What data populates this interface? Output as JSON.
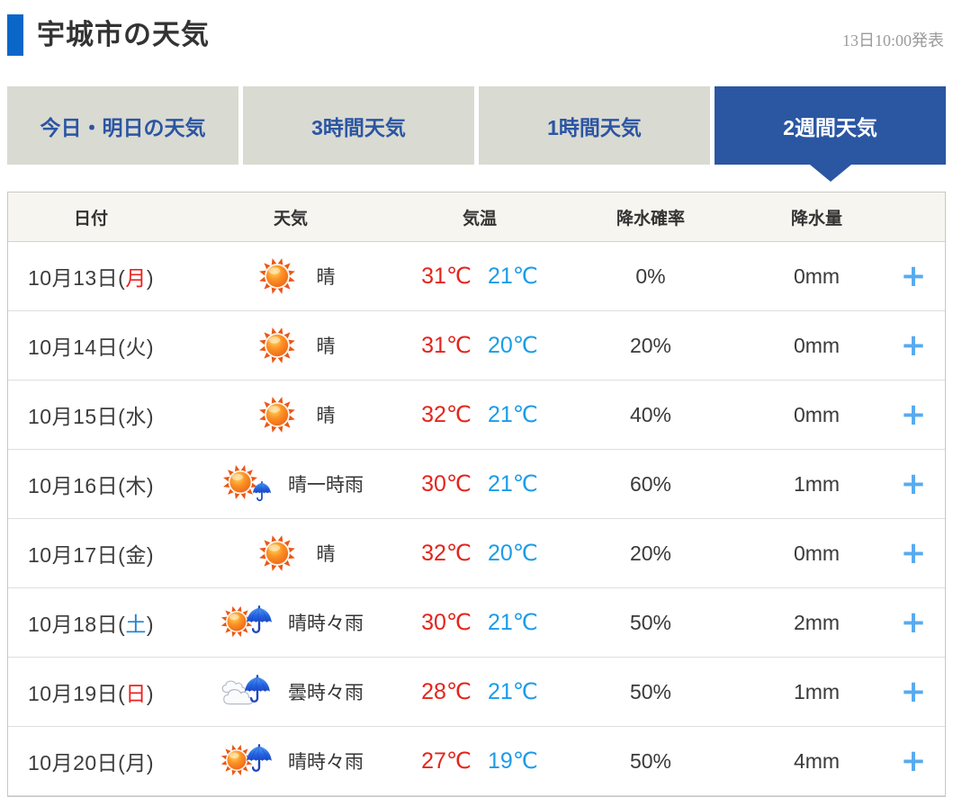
{
  "page": {
    "title": "宇城市の天気",
    "published": "13日10:00発表"
  },
  "tabs": [
    {
      "label": "今日・明日の天気",
      "active": false
    },
    {
      "label": "3時間天気",
      "active": false
    },
    {
      "label": "1時間天気",
      "active": false
    },
    {
      "label": "2週間天気",
      "active": true
    }
  ],
  "table": {
    "headers": {
      "date": "日付",
      "weather": "天気",
      "temp": "気温",
      "precip_prob": "降水確率",
      "precip_amount": "降水量"
    },
    "paren_open": "(",
    "paren_close": ")",
    "expand_label": "+",
    "rows": [
      {
        "date": "10月13日",
        "dow": "月",
        "dow_type": "holiday",
        "weather": "晴",
        "icon": "sun",
        "temp_high": "31℃",
        "temp_low": "21℃",
        "precip_prob": "0%",
        "precip_amount": "0mm"
      },
      {
        "date": "10月14日",
        "dow": "火",
        "dow_type": "weekday",
        "weather": "晴",
        "icon": "sun",
        "temp_high": "31℃",
        "temp_low": "20℃",
        "precip_prob": "20%",
        "precip_amount": "0mm"
      },
      {
        "date": "10月15日",
        "dow": "水",
        "dow_type": "weekday",
        "weather": "晴",
        "icon": "sun",
        "temp_high": "32℃",
        "temp_low": "21℃",
        "precip_prob": "40%",
        "precip_amount": "0mm"
      },
      {
        "date": "10月16日",
        "dow": "木",
        "dow_type": "weekday",
        "weather": "晴一時雨",
        "icon": "sun-small-umbrella",
        "temp_high": "30℃",
        "temp_low": "21℃",
        "precip_prob": "60%",
        "precip_amount": "1mm"
      },
      {
        "date": "10月17日",
        "dow": "金",
        "dow_type": "weekday",
        "weather": "晴",
        "icon": "sun",
        "temp_high": "32℃",
        "temp_low": "20℃",
        "precip_prob": "20%",
        "precip_amount": "0mm"
      },
      {
        "date": "10月18日",
        "dow": "土",
        "dow_type": "saturday",
        "weather": "晴時々雨",
        "icon": "sun-umbrella",
        "temp_high": "30℃",
        "temp_low": "21℃",
        "precip_prob": "50%",
        "precip_amount": "2mm"
      },
      {
        "date": "10月19日",
        "dow": "日",
        "dow_type": "sunday",
        "weather": "曇時々雨",
        "icon": "cloud-umbrella",
        "temp_high": "28℃",
        "temp_low": "21℃",
        "precip_prob": "50%",
        "precip_amount": "1mm"
      },
      {
        "date": "10月20日",
        "dow": "月",
        "dow_type": "weekday",
        "weather": "晴時々雨",
        "icon": "sun-umbrella",
        "temp_high": "27℃",
        "temp_low": "19℃",
        "precip_prob": "50%",
        "precip_amount": "4mm"
      }
    ]
  },
  "colors": {
    "accent_blue": "#0a66c8",
    "tab_active_bg": "#2b56a2",
    "temp_high_red": "#e3251d",
    "temp_low_blue": "#1b9ce8",
    "dow_holiday": "#ea2320",
    "dow_sunday": "#ea2320",
    "dow_saturday": "#1e82d2",
    "plus_blue": "#58aaef"
  }
}
